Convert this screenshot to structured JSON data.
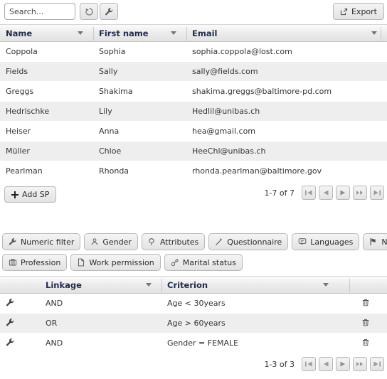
{
  "toolbar": {
    "search_placeholder": "Search...",
    "search_value": "",
    "refresh_icon": "refresh-icon",
    "settings_icon": "wrench-icon",
    "export_label": "Export",
    "export_icon": "external-link-icon"
  },
  "people_table": {
    "columns": [
      {
        "label": "Name",
        "sortable": true
      },
      {
        "label": "First name",
        "sortable": true
      },
      {
        "label": "Email",
        "sortable": true
      }
    ],
    "rows": [
      {
        "name": "Coppola",
        "first_name": "Sophia",
        "email": "sophia.coppola@lost.com"
      },
      {
        "name": "Fields",
        "first_name": "Sally",
        "email": "sally@fields.com"
      },
      {
        "name": "Greggs",
        "first_name": "Shakima",
        "email": "shakima.greggs@baltimore-pd.com"
      },
      {
        "name": "Hedrischke",
        "first_name": "Lily",
        "email": "Hedlil@unibas.ch"
      },
      {
        "name": "Heiser",
        "first_name": "Anna",
        "email": "hea@gmail.com"
      },
      {
        "name": "Müller",
        "first_name": "Chloe",
        "email": "HeeChl@unibas.ch"
      },
      {
        "name": "Pearlman",
        "first_name": "Rhonda",
        "email": "rhonda.pearlman@baltimore.gov"
      }
    ],
    "add_button_label": "Add SP",
    "add_button_icon": "plus-icon",
    "pagination": {
      "range_label": "1-7 of 7",
      "buttons": [
        "first-page",
        "previous-page",
        "next-page",
        "fast-forward-page",
        "last-page"
      ]
    }
  },
  "filters": {
    "row1": [
      {
        "label": "Numeric filter",
        "icon": "wrench-icon"
      },
      {
        "label": "Gender",
        "icon": "person-icon"
      },
      {
        "label": "Attributes",
        "icon": "magnifier-icon"
      },
      {
        "label": "Questionnaire",
        "icon": "wand-icon"
      },
      {
        "label": "Languages",
        "icon": "speech-bubble-icon"
      },
      {
        "label": "Nationality",
        "icon": "flag-icon"
      }
    ],
    "row2": [
      {
        "label": "Profession",
        "icon": "briefcase-icon"
      },
      {
        "label": "Work permission",
        "icon": "document-icon"
      },
      {
        "label": "Marital status",
        "icon": "rings-icon"
      }
    ]
  },
  "criteria_table": {
    "columns": [
      {
        "label": "",
        "sortable": false
      },
      {
        "label": "Linkage",
        "sortable": true
      },
      {
        "label": "Criterion",
        "sortable": true
      },
      {
        "label": "",
        "sortable": false
      }
    ],
    "rows": [
      {
        "edit_icon": "wrench-icon",
        "linkage": "AND",
        "criterion": "Age < 30years",
        "delete_icon": "trash-icon"
      },
      {
        "edit_icon": "wrench-icon",
        "linkage": "OR",
        "criterion": "Age > 60years",
        "delete_icon": "trash-icon"
      },
      {
        "edit_icon": "wrench-icon",
        "linkage": "AND",
        "criterion": "Gender = FEMALE",
        "delete_icon": "trash-icon"
      }
    ],
    "pagination": {
      "range_label": "1-3 of 3",
      "buttons": [
        "first-page",
        "previous-page",
        "next-page",
        "fast-forward-page",
        "last-page"
      ]
    }
  },
  "colors": {
    "header_text": "#1f2b4d",
    "row_alt": "#eeeeee",
    "button_face": "#e9e9e9",
    "border": "#b8b8b8"
  }
}
